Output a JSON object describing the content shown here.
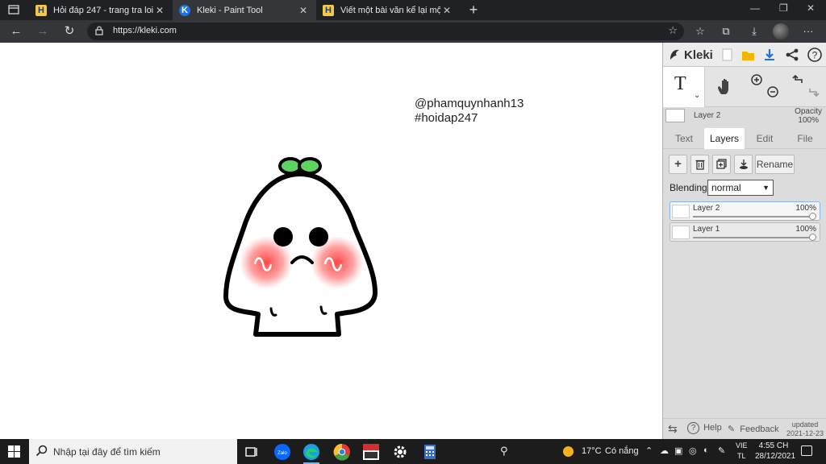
{
  "browser": {
    "tabs": [
      {
        "title": "Hỏi đáp 247 - trang tra loi",
        "favicon": "H",
        "active": false
      },
      {
        "title": "Kleki - Paint Tool",
        "favicon": "K",
        "active": true
      },
      {
        "title": "Viết một bài văn kể lại một lần e",
        "favicon": "H",
        "active": false
      }
    ],
    "url": "https://kleki.com"
  },
  "canvas": {
    "line1": "@phamquynhanh13",
    "line2": "#hoidap247"
  },
  "kleki": {
    "logo_text": "Kleki",
    "current_layer": "Layer 2",
    "opacity_label": "Opacity",
    "opacity_value": "100%",
    "tabs": [
      "Text",
      "Layers",
      "Edit",
      "File"
    ],
    "active_tab": "Layers",
    "rename_label": "Rename",
    "blending_label": "Blending",
    "blending_value": "normal",
    "layers": [
      {
        "name": "Layer 2",
        "opacity": "100%",
        "selected": true
      },
      {
        "name": "Layer 1",
        "opacity": "100%",
        "selected": false
      }
    ],
    "help_label": "Help",
    "feedback_label": "Feedback",
    "updated_label": "updated",
    "updated_date": "2021-12-23"
  },
  "taskbar": {
    "search_placeholder": "Nhập tại đây để tìm kiếm",
    "weather_temp": "17°C",
    "weather_text": "Có nắng",
    "lang_top": "VIE",
    "lang_bottom": "TL",
    "time": "4:55 CH",
    "date": "28/12/2021"
  },
  "colors": {
    "accent_blue": "#1a73e8",
    "sprout_green": "#5fd35f",
    "blush_red": "#ff4a4a"
  }
}
